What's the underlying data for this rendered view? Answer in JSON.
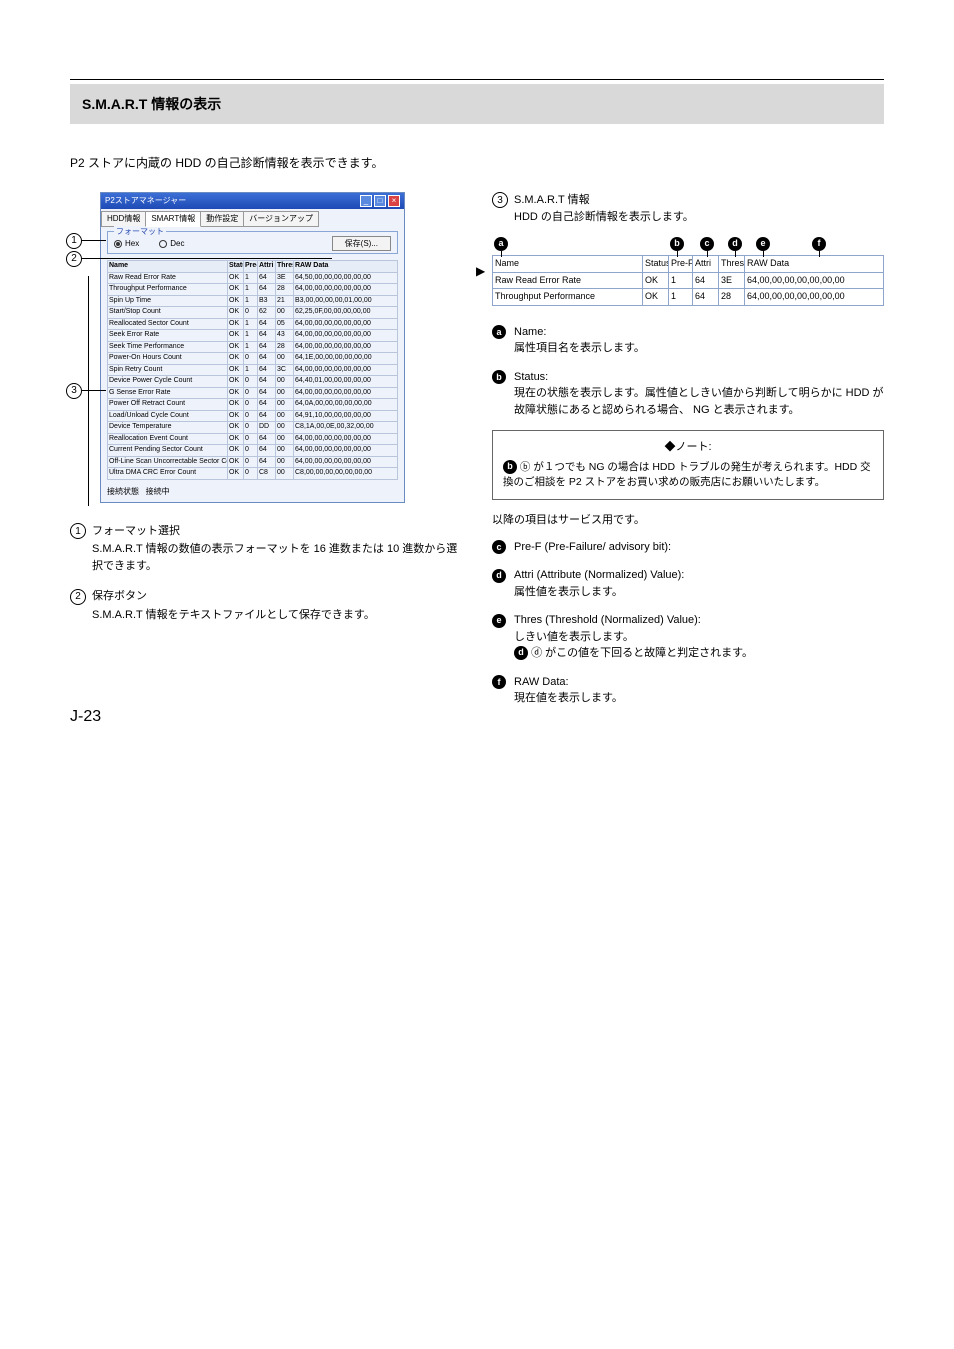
{
  "page_number": "J-23",
  "band_title": "S.M.A.R.T 情報の表示",
  "intro": "P2 ストアに内蔵の HDD の自己診断情報を表示できます。",
  "screenshot": {
    "window_title": "P2ストアマネージャー",
    "tabs": [
      "HDD情報",
      "SMART情報",
      "動作設定",
      "バージョンアップ"
    ],
    "active_tab_index": 1,
    "format_legend": "フォーマット",
    "radio_hex": "Hex",
    "radio_dec": "Dec",
    "save_button": "保存(S)...",
    "columns": [
      "Name",
      "Status",
      "Pre-F",
      "Attri",
      "Thres",
      "RAW Data"
    ],
    "rows": [
      {
        "name": "Raw Read Error Rate",
        "s": "OK",
        "p": "1",
        "a": "64",
        "t": "3E",
        "d": "64,50,00,00,00,00,00,00"
      },
      {
        "name": "Throughput Performance",
        "s": "OK",
        "p": "1",
        "a": "64",
        "t": "28",
        "d": "64,00,00,00,00,00,00,00"
      },
      {
        "name": "Spin Up Time",
        "s": "OK",
        "p": "1",
        "a": "B3",
        "t": "21",
        "d": "B3,00,00,00,00,01,00,00"
      },
      {
        "name": "Start/Stop Count",
        "s": "OK",
        "p": "0",
        "a": "62",
        "t": "00",
        "d": "62,25,0F,00,00,00,00,00"
      },
      {
        "name": "Reallocated Sector Count",
        "s": "OK",
        "p": "1",
        "a": "64",
        "t": "05",
        "d": "64,00,00,00,00,00,00,00"
      },
      {
        "name": "Seek Error Rate",
        "s": "OK",
        "p": "1",
        "a": "64",
        "t": "43",
        "d": "64,00,00,00,00,00,00,00"
      },
      {
        "name": "Seek Time Performance",
        "s": "OK",
        "p": "1",
        "a": "64",
        "t": "28",
        "d": "64,00,00,00,00,00,00,00"
      },
      {
        "name": "Power-On Hours Count",
        "s": "OK",
        "p": "0",
        "a": "64",
        "t": "00",
        "d": "64,1E,00,00,00,00,00,00"
      },
      {
        "name": "Spin Retry Count",
        "s": "OK",
        "p": "1",
        "a": "64",
        "t": "3C",
        "d": "64,00,00,00,00,00,00,00"
      },
      {
        "name": "Device Power Cycle Count",
        "s": "OK",
        "p": "0",
        "a": "64",
        "t": "00",
        "d": "64,40,01,00,00,00,00,00"
      },
      {
        "name": "G Sense Error Rate",
        "s": "OK",
        "p": "0",
        "a": "64",
        "t": "00",
        "d": "64,00,00,00,00,00,00,00"
      },
      {
        "name": "Power Off Retract Count",
        "s": "OK",
        "p": "0",
        "a": "64",
        "t": "00",
        "d": "64,0A,00,00,00,00,00,00"
      },
      {
        "name": "Load/Unload Cycle Count",
        "s": "OK",
        "p": "0",
        "a": "64",
        "t": "00",
        "d": "64,91,10,00,00,00,00,00"
      },
      {
        "name": "Device Temperature",
        "s": "OK",
        "p": "0",
        "a": "DD",
        "t": "00",
        "d": "C8,1A,00,0E,00,32,00,00"
      },
      {
        "name": "Reallocation Event Count",
        "s": "OK",
        "p": "0",
        "a": "64",
        "t": "00",
        "d": "64,00,00,00,00,00,00,00"
      },
      {
        "name": "Current Pending Sector Count",
        "s": "OK",
        "p": "0",
        "a": "64",
        "t": "00",
        "d": "64,00,00,00,00,00,00,00"
      },
      {
        "name": "Off-Line Scan Uncorrectable Sector Count",
        "s": "OK",
        "p": "0",
        "a": "64",
        "t": "00",
        "d": "64,00,00,00,00,00,00,00"
      },
      {
        "name": "Ultra DMA CRC Error Count",
        "s": "OK",
        "p": "0",
        "a": "C8",
        "t": "00",
        "d": "C8,00,00,00,00,00,00,00"
      }
    ],
    "status_label": "接続状態",
    "status_value": "接続中"
  },
  "zoom": {
    "columns": [
      "Name",
      "Status",
      "Pre-F",
      "Attri",
      "Thres",
      "RAW Data"
    ],
    "rows": [
      {
        "name": "Raw Read Error Rate",
        "s": "OK",
        "p": "1",
        "a": "64",
        "t": "3E",
        "d": "64,00,00,00,00,00,00,00"
      },
      {
        "name": "Throughput Performance",
        "s": "OK",
        "p": "1",
        "a": "64",
        "t": "28",
        "d": "64,00,00,00,00,00,00,00"
      }
    ]
  },
  "left_desc": {
    "1": {
      "title": "フォーマット選択",
      "body": "S.M.A.R.T 情報の数値の表示フォーマットを 16 進数または 10 進数から選択できます。"
    },
    "2": {
      "title": "保存ボタン",
      "body": "S.M.A.R.T 情報をテキストファイルとして保存できます。"
    }
  },
  "right_desc": {
    "3": {
      "title": "S.M.A.R.T 情報",
      "body": "HDD の自己診断情報を表示します。",
      "a": {
        "label": "Name:",
        "body": "属性項目名を表示します。"
      },
      "b": {
        "label": "Status:",
        "body": "現在の状態を表示します。属性値としきい値から判断して明らかに HDD が故障状態にあると認められる場合、 NG と表示されます。"
      },
      "note_title": "◆ノート:",
      "note_body": "ⓑ が１つでも NG の場合は HDD トラブルの発生が考えられます。HDD 交換のご相談を P2 ストアをお買い求めの販売店にお願いいたします。",
      "c_pre": "以降の項目はサービス用です。",
      "c": {
        "label": "Pre-F (Pre-Failure/ advisory bit):"
      },
      "d": {
        "label": "Attri (Attribute (Normalized) Value):",
        "body": "属性値を表示します。"
      },
      "e": {
        "label": "Thres (Threshold (Normalized) Value):",
        "body": "しきい値を表示します。",
        "extra": "ⓓ がこの値を下回ると故障と判定されます。"
      },
      "f": {
        "label": "RAW Data:",
        "body": "現在値を表示します。"
      }
    }
  }
}
